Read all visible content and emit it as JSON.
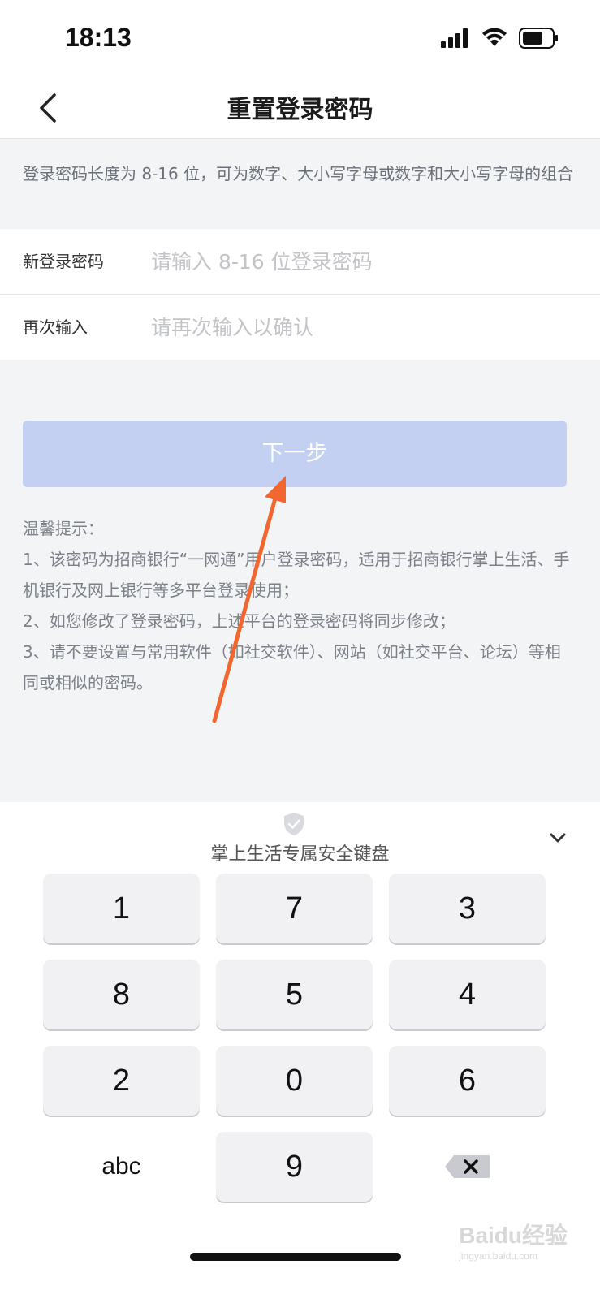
{
  "status_bar": {
    "time": "18:13"
  },
  "nav": {
    "title": "重置登录密码"
  },
  "notice": "登录密码长度为 8-16 位，可为数字、大小写字母或数字和大小写字母的组合",
  "form": {
    "new_password": {
      "label": "新登录密码",
      "placeholder": "请输入 8-16 位登录密码"
    },
    "confirm_password": {
      "label": "再次输入",
      "placeholder": "请再次输入以确认"
    }
  },
  "next_button": "下一步",
  "tips": [
    "温馨提示：",
    "1、该密码为招商银行“一网通”用户登录密码，适用于招商银行掌上生活、手机银行及网上银行等多平台登录使用；",
    "2、如您修改了登录密码，上述平台的登录密码将同步修改；",
    "3、请不要设置与常用软件（如社交软件）、网站（如社交平台、论坛）等相同或相似的密码。"
  ],
  "keyboard": {
    "title": "掌上生活专属安全键盘",
    "keys": [
      "1",
      "7",
      "3",
      "8",
      "5",
      "4",
      "2",
      "0",
      "6",
      "abc",
      "9",
      "delete"
    ]
  },
  "watermark": {
    "brand": "Baidu经验",
    "url": "jingyan.baidu.com"
  },
  "colors": {
    "button_disabled": "#c3d0f2",
    "annotation_arrow": "#f2662f"
  }
}
